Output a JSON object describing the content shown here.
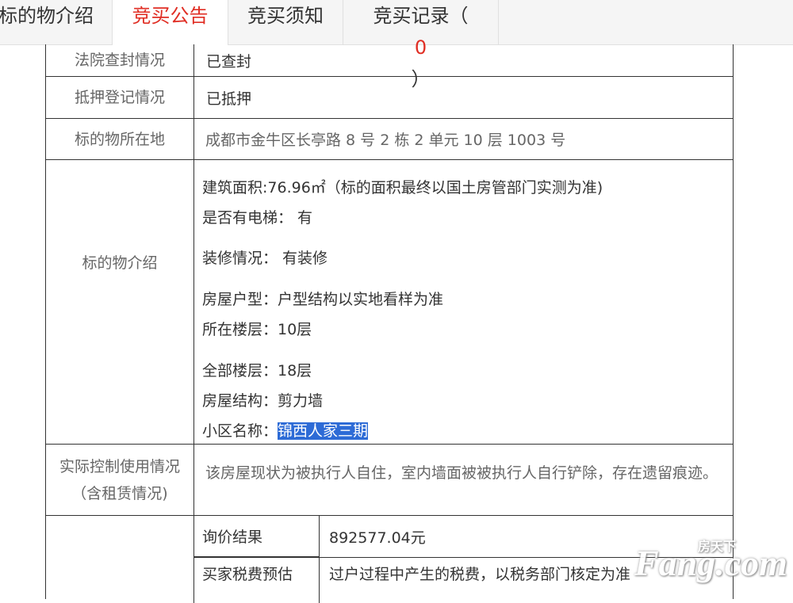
{
  "tabs": [
    {
      "label": "标的物介绍"
    },
    {
      "label": "竞买公告"
    },
    {
      "label": "竞买须知"
    },
    {
      "label": "竞买记录（",
      "count": "0",
      "suffix": "）"
    }
  ],
  "rows": {
    "court_seal": {
      "label": "法院查封情况",
      "value": "已查封"
    },
    "mortgage": {
      "label": "抵押登记情况",
      "value": "已抵押"
    },
    "location": {
      "label": "标的物所在地",
      "value": "成都市金牛区长亭路 8 号 2 栋 2 单元 10 层 1003 号"
    },
    "intro": {
      "label": "标的物介绍",
      "area": "建筑面积:76.96㎡（标的面积最终以国土房管部门实测为准)",
      "elevator": "是否有电梯： 有",
      "decoration": "装修情况： 有装修",
      "layout": "房屋户型：户型结构以实地看样为准",
      "floor": "所在楼层：10层",
      "total_floors": "全部楼层：18层",
      "structure": "房屋结构：剪力墙",
      "community_key": "小区名称：",
      "community_value": "锦西人家三期"
    },
    "control": {
      "label_line1": "实际控制使用情况",
      "label_line2": "（含租赁情况)",
      "value": "该房屋现状为被执行人自住，室内墙面被被执行人自行铲除，存在遗留痕迹。"
    },
    "inquiry": {
      "key": "询价结果",
      "value": "892577.04元"
    },
    "tax": {
      "key": "买家税费预估",
      "value": "过户过程中产生的税费，以税务部门核定为准"
    }
  },
  "watermark": {
    "small": "房天下",
    "big": "Fang.com"
  }
}
